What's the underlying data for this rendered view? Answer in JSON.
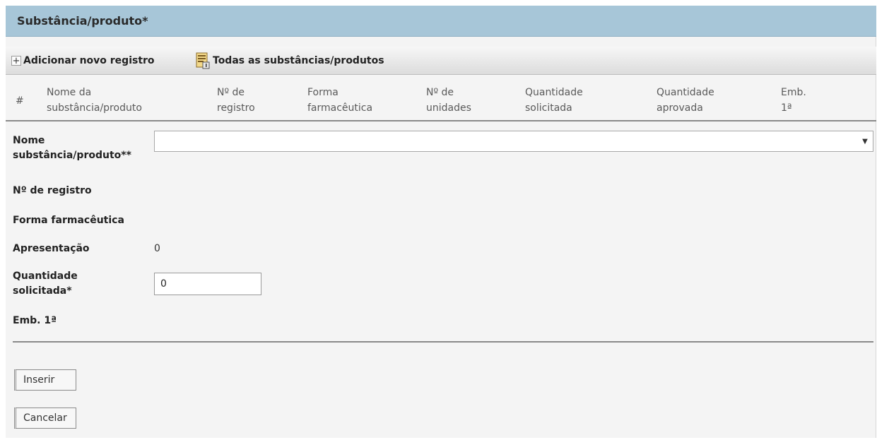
{
  "panel": {
    "title": "Substância/produto*"
  },
  "toolbar": {
    "add_label": "Adicionar novo registro",
    "all_label": "Todas as substâncias/produtos"
  },
  "table": {
    "columns": [
      {
        "line1": "#",
        "line2": ""
      },
      {
        "line1": "Nome da",
        "line2": "substância/produto"
      },
      {
        "line1": "Nº de",
        "line2": "registro"
      },
      {
        "line1": "Forma",
        "line2": "farmacêutica"
      },
      {
        "line1": "Nº de",
        "line2": "unidades"
      },
      {
        "line1": "Quantidade",
        "line2": "solicitada"
      },
      {
        "line1": "Quantidade",
        "line2": "aprovada"
      },
      {
        "line1": "Emb.",
        "line2": "1ª"
      }
    ]
  },
  "form": {
    "nome_label_1": "Nome",
    "nome_label_2": "substância/produto**",
    "nome_value": "",
    "registro_label": "Nº de registro",
    "forma_label": "Forma farmacêutica",
    "apresentacao_label": "Apresentação",
    "apresentacao_value": "0",
    "quantidade_label_1": "Quantidade",
    "quantidade_label_2": "solicitada*",
    "quantidade_value": "0",
    "emb_label": "Emb. 1ª"
  },
  "actions": {
    "insert_label": "Inserir",
    "cancel_label": "Cancelar"
  }
}
